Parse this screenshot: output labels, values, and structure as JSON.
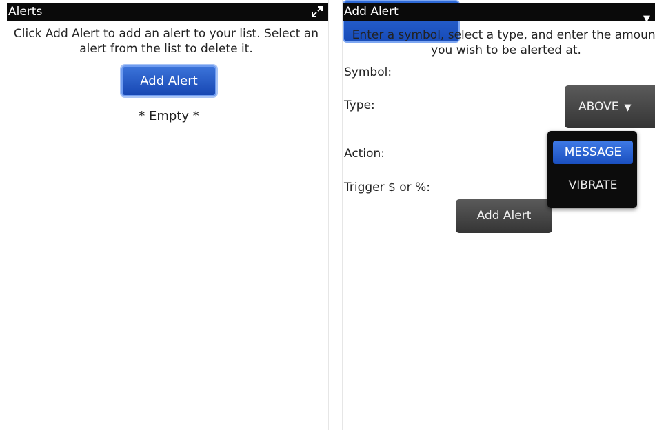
{
  "left_screen": {
    "title": "Alerts",
    "instructions": "Click Add Alert to add an alert to your list. Select an alert from the list to delete it.",
    "add_button": "Add Alert",
    "empty_text": "* Empty *",
    "icons": {
      "expand": "expand-arrows-icon"
    }
  },
  "right_screen": {
    "title": "Add Alert",
    "instructions": "Enter a symbol, select a type, and enter the amount you wish to be alerted at.",
    "labels": {
      "symbol": "Symbol:",
      "type": "Type:",
      "action": "Action:",
      "trigger": "Trigger $ or %:"
    },
    "type_select": {
      "value": "ABOVE"
    },
    "action_dropdown": {
      "options": [
        "MESSAGE",
        "VIBRATE"
      ],
      "highlighted": "MESSAGE"
    },
    "add_button": "Add Alert"
  },
  "colors": {
    "titlebar": "#0a0a0a",
    "primary_button": "#1f55c6",
    "dark_button": "#444444"
  }
}
